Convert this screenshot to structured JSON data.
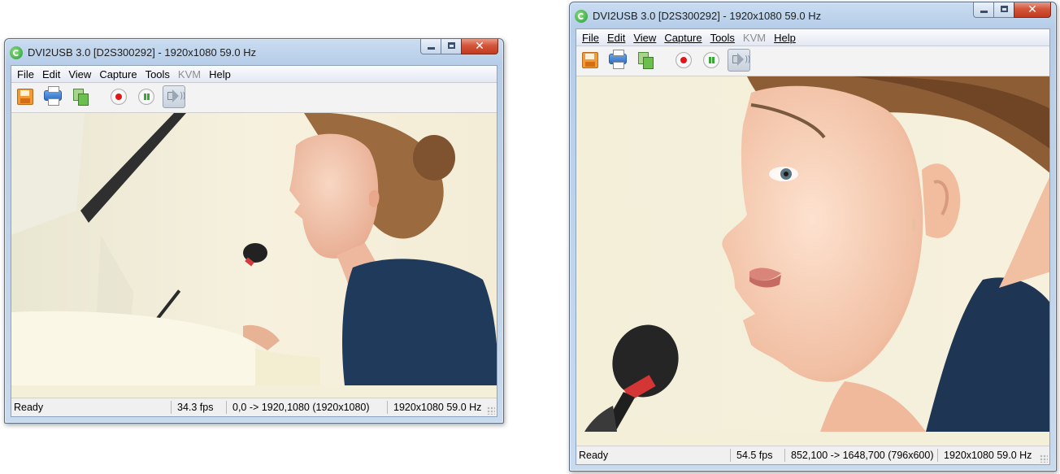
{
  "windows": [
    {
      "title": "DVI2USB 3.0 [D2S300292]  - 1920x1080 59.0 Hz",
      "menu": [
        {
          "label": "File",
          "enabled": true
        },
        {
          "label": "Edit",
          "enabled": true
        },
        {
          "label": "View",
          "enabled": true
        },
        {
          "label": "Capture",
          "enabled": true
        },
        {
          "label": "Tools",
          "enabled": true
        },
        {
          "label": "KVM",
          "enabled": false
        },
        {
          "label": "Help",
          "enabled": true
        }
      ],
      "toolbar": [
        "save-icon",
        "print-icon",
        "copy-icon",
        "record-icon",
        "pause-icon",
        "speaker-icon"
      ],
      "status": {
        "text": "Ready",
        "fps": "34.3 fps",
        "region": "0,0 -> 1920,1080 (1920x1080)",
        "mode": "1920x1080 59.0 Hz"
      }
    },
    {
      "title": "DVI2USB 3.0 [D2S300292]  - 1920x1080 59.0 Hz",
      "menu": [
        {
          "label": "File",
          "enabled": true
        },
        {
          "label": "Edit",
          "enabled": true
        },
        {
          "label": "View",
          "enabled": true
        },
        {
          "label": "Capture",
          "enabled": true
        },
        {
          "label": "Tools",
          "enabled": true
        },
        {
          "label": "KVM",
          "enabled": false
        },
        {
          "label": "Help",
          "enabled": true
        }
      ],
      "toolbar": [
        "save-icon",
        "print-icon",
        "copy-icon",
        "record-icon",
        "pause-icon",
        "speaker-icon"
      ],
      "status": {
        "text": "Ready",
        "fps": "54.5 fps",
        "region": "852,100 -> 1648,700 (796x600)",
        "mode": "1920x1080 59.0 Hz"
      }
    }
  ],
  "colors": {
    "close_button": "#c23b1f",
    "record_dot": "#e0161b",
    "pause_bars": "#3aa637"
  }
}
